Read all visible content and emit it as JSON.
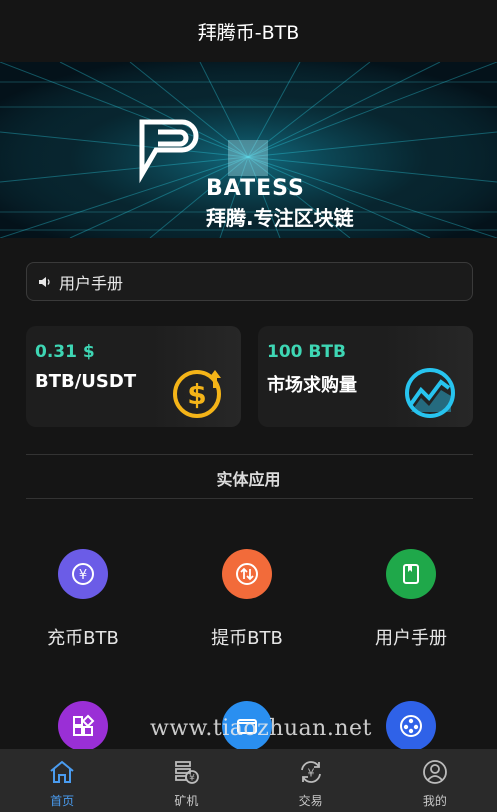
{
  "header": {
    "title": "拜腾币-BTB"
  },
  "banner": {
    "brand": "BATESS",
    "slogan": "拜腾.专注区块链"
  },
  "notice": {
    "text": "用户手册"
  },
  "cards": [
    {
      "value": "0.31 $",
      "label": "BTB/USDT",
      "icon": "dollar-coin-icon"
    },
    {
      "value": "100 BTB",
      "label": "市场求购量",
      "icon": "trend-chart-icon"
    }
  ],
  "section": {
    "title": "实体应用"
  },
  "apps": [
    {
      "label": "充币BTB",
      "color": "#6b5ce7",
      "icon": "yuan-circle-icon"
    },
    {
      "label": "提币BTB",
      "color": "#f26b3a",
      "icon": "exchange-arrows-icon"
    },
    {
      "label": "用户手册",
      "color": "#1fa84a",
      "icon": "book-icon"
    },
    {
      "label": "",
      "color": "#9a2fd6",
      "icon": "grid-apps-icon"
    },
    {
      "label": "",
      "color": "#2a8ff0",
      "icon": "wallet-icon"
    },
    {
      "label": "",
      "color": "#2f62e8",
      "icon": "film-reel-icon"
    }
  ],
  "watermark": "www.tiaozhuan.net",
  "tabs": [
    {
      "label": "首页",
      "icon": "home-icon",
      "active": true
    },
    {
      "label": "矿机",
      "icon": "mining-machine-icon",
      "active": false
    },
    {
      "label": "交易",
      "icon": "trade-icon",
      "active": false
    },
    {
      "label": "我的",
      "icon": "user-icon",
      "active": false
    }
  ],
  "colors": {
    "accent": "#4a9cf0",
    "value_green": "#3ed6b4",
    "background": "#151515"
  }
}
